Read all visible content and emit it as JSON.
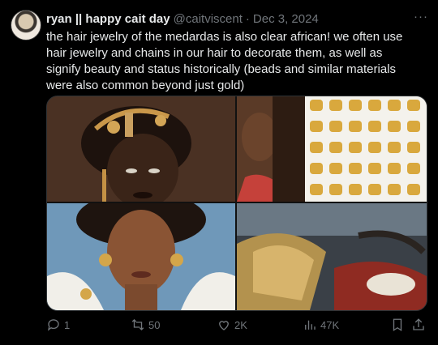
{
  "tweet": {
    "author_name": "ryan || happy cait day",
    "handle": "@caitviscent",
    "separator": "·",
    "date": "Dec 3, 2024",
    "more": "···",
    "text": "the hair jewelry of the medardas is also clear african! we often use hair jewelry and chains in our hair to decorate them, as well as signify beauty and status historically (beads and similar materials were also common beyond just gold)",
    "media": [
      {
        "name": "illustrated-woman-gold-hair-jewelry",
        "icon": "image"
      },
      {
        "name": "braided-hair-and-gold-cuffs",
        "icon": "image"
      },
      {
        "name": "woman-with-gold-earrings",
        "icon": "image"
      },
      {
        "name": "gold-headpiece-closeup",
        "icon": "image"
      }
    ],
    "actions": {
      "replies": "1",
      "reposts": "50",
      "likes": "2K",
      "views": "47K"
    }
  }
}
